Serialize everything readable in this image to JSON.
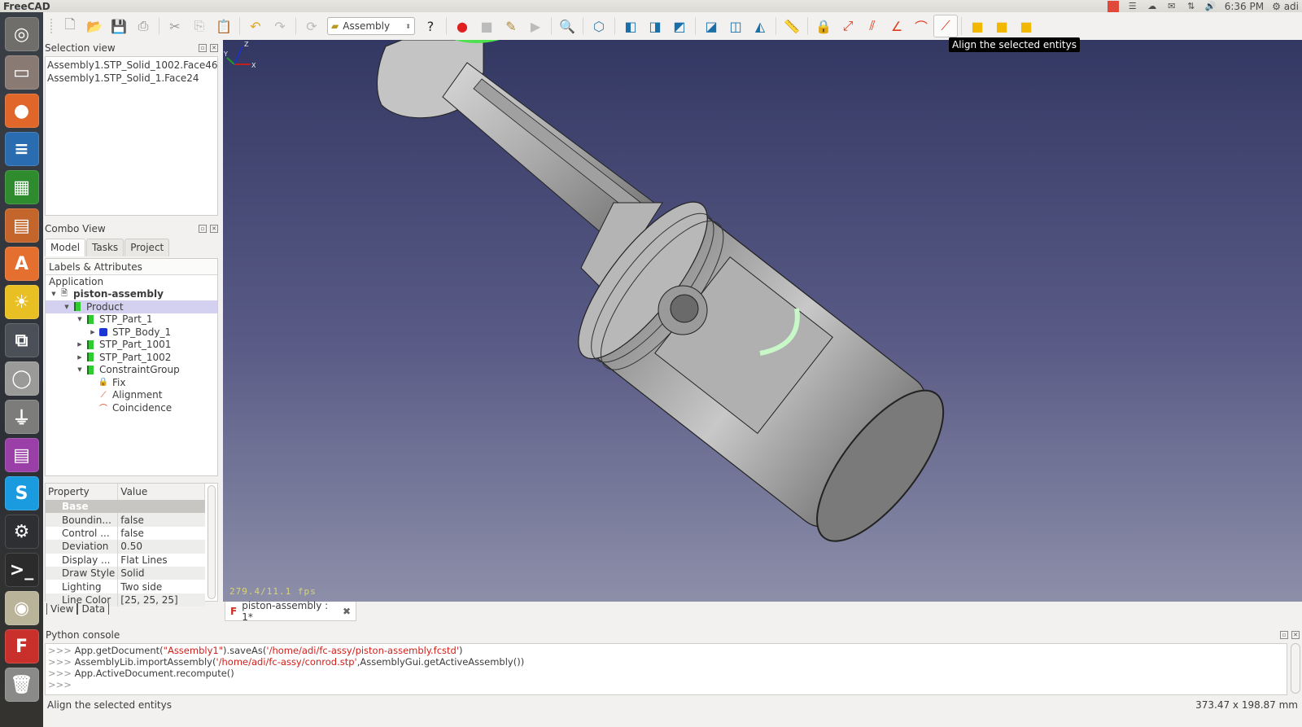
{
  "topbar": {
    "app_title": "FreeCAD",
    "clock": "6:36 PM",
    "user": "adi",
    "tray_icons": [
      "record-indicator",
      "notes-icon",
      "cloud-icon",
      "mail-icon",
      "network-icon",
      "volume-icon"
    ]
  },
  "launcher": {
    "items": [
      {
        "name": "dash-home",
        "glyph": "◎",
        "color": "#6f6e6a"
      },
      {
        "name": "files",
        "glyph": "▭",
        "color": "#8a7a74"
      },
      {
        "name": "firefox",
        "glyph": "●",
        "color": "#e0662a"
      },
      {
        "name": "writer",
        "glyph": "≡",
        "color": "#2a6cb0"
      },
      {
        "name": "calc",
        "glyph": "▦",
        "color": "#2e8b2e"
      },
      {
        "name": "impress",
        "glyph": "▤",
        "color": "#c4652c"
      },
      {
        "name": "software-center",
        "glyph": "A",
        "color": "#e46f2e"
      },
      {
        "name": "weather",
        "glyph": "☀",
        "color": "#e9c023"
      },
      {
        "name": "workspaces",
        "glyph": "⧉",
        "color": "#4b4f58"
      },
      {
        "name": "disk",
        "glyph": "◯",
        "color": "#9a9a98"
      },
      {
        "name": "usb",
        "glyph": "⏚",
        "color": "#7c7c7a"
      },
      {
        "name": "app-window",
        "glyph": "▤",
        "color": "#9b3fa8"
      },
      {
        "name": "skype",
        "glyph": "S",
        "color": "#1a9be0"
      },
      {
        "name": "steam",
        "glyph": "⚙",
        "color": "#2d2f33"
      },
      {
        "name": "terminal",
        "glyph": ">_",
        "color": "#2b2b2b"
      },
      {
        "name": "speaker",
        "glyph": "◉",
        "color": "#b9b39a"
      },
      {
        "name": "freecad",
        "glyph": "F",
        "color": "#c9302c"
      },
      {
        "name": "trash",
        "glyph": "🗑",
        "color": "#8a8a88"
      }
    ]
  },
  "toolbar": {
    "workbench": "Assembly",
    "tooltip": "Align the selected entitys",
    "buttons": [
      {
        "name": "new",
        "glyph": "🗋",
        "color": "#888"
      },
      {
        "name": "open",
        "glyph": "📂",
        "color": "#2a6cb0"
      },
      {
        "name": "save",
        "glyph": "💾",
        "color": "#2a6cb0"
      },
      {
        "name": "print",
        "glyph": "⎙",
        "color": "#888"
      },
      {
        "name": "cut",
        "glyph": "✂",
        "color": "#999"
      },
      {
        "name": "copy",
        "glyph": "⎘",
        "color": "#bbb"
      },
      {
        "name": "paste",
        "glyph": "📋",
        "color": "#999"
      },
      {
        "name": "undo",
        "glyph": "↶",
        "color": "#e0a820"
      },
      {
        "name": "redo",
        "glyph": "↷",
        "color": "#bbb"
      },
      {
        "name": "refresh",
        "glyph": "⟳",
        "color": "#bbb"
      }
    ],
    "buttons2": [
      {
        "name": "whats-this",
        "glyph": "?",
        "color": "#222"
      },
      {
        "name": "macro-record",
        "glyph": "●",
        "color": "#e02020"
      },
      {
        "name": "macro-stop",
        "glyph": "■",
        "color": "#bbb"
      },
      {
        "name": "macro-edit",
        "glyph": "✎",
        "color": "#b08a3a"
      },
      {
        "name": "macro-play",
        "glyph": "▶",
        "color": "#bbb"
      },
      {
        "name": "fit-all",
        "glyph": "🔍",
        "color": "#1a66a8"
      },
      {
        "name": "view-isometric",
        "glyph": "⬡",
        "color": "#3a7fa8"
      },
      {
        "name": "view-front",
        "glyph": "◧",
        "color": "#1a6fa8"
      },
      {
        "name": "view-top",
        "glyph": "◨",
        "color": "#1a6fa8"
      },
      {
        "name": "view-right",
        "glyph": "◩",
        "color": "#1a6fa8"
      },
      {
        "name": "view-rear",
        "glyph": "◪",
        "color": "#1a6fa8"
      },
      {
        "name": "view-bottom",
        "glyph": "◫",
        "color": "#1a6fa8"
      },
      {
        "name": "view-left",
        "glyph": "◭",
        "color": "#1a6fa8"
      },
      {
        "name": "measure",
        "glyph": "📏",
        "color": "#1a4f78"
      },
      {
        "name": "constraint-fix",
        "glyph": "🔒",
        "color": "#e03a1a"
      },
      {
        "name": "constraint-distance",
        "glyph": "⤢",
        "color": "#e03a1a"
      },
      {
        "name": "constraint-parallel",
        "glyph": "⫽",
        "color": "#e03a1a"
      },
      {
        "name": "constraint-angle",
        "glyph": "∠",
        "color": "#e03a1a"
      },
      {
        "name": "constraint-coincidence",
        "glyph": "⌒",
        "color": "#e03a1a"
      },
      {
        "name": "constraint-align",
        "glyph": "⟋",
        "color": "#e03a1a"
      },
      {
        "name": "part-add-1",
        "glyph": "■",
        "color": "#f2b800"
      },
      {
        "name": "part-add-2",
        "glyph": "■",
        "color": "#f2b800"
      },
      {
        "name": "part-add-3",
        "glyph": "■",
        "color": "#f2b800"
      }
    ]
  },
  "selection_view": {
    "title": "Selection view",
    "items": [
      "Assembly1.STP_Solid_1002.Face46",
      "Assembly1.STP_Solid_1.Face24"
    ]
  },
  "combo_view": {
    "title": "Combo View",
    "tabs": [
      "Model",
      "Tasks",
      "Project"
    ],
    "tree_header": "Labels & Attributes",
    "tree": [
      {
        "label": "Application",
        "depth": 0,
        "twisty": "",
        "icon": "none",
        "bold": false
      },
      {
        "label": "piston-assembly",
        "depth": 0,
        "twisty": "▼",
        "icon": "document",
        "bold": true
      },
      {
        "label": "Product",
        "depth": 1,
        "twisty": "▼",
        "icon": "part",
        "bold": false,
        "selected": true
      },
      {
        "label": "STP_Part_1",
        "depth": 2,
        "twisty": "▼",
        "icon": "part",
        "bold": false
      },
      {
        "label": "STP_Body_1",
        "depth": 3,
        "twisty": "▶",
        "icon": "body",
        "bold": false
      },
      {
        "label": "STP_Part_1001",
        "depth": 2,
        "twisty": "▶",
        "icon": "part",
        "bold": false
      },
      {
        "label": "STP_Part_1002",
        "depth": 2,
        "twisty": "▶",
        "icon": "part",
        "bold": false
      },
      {
        "label": "ConstraintGroup",
        "depth": 2,
        "twisty": "▼",
        "icon": "part",
        "bold": false
      },
      {
        "label": "Fix",
        "depth": 3,
        "twisty": "",
        "icon": "lock",
        "bold": false
      },
      {
        "label": "Alignment",
        "depth": 3,
        "twisty": "",
        "icon": "align",
        "bold": false
      },
      {
        "label": "Coincidence",
        "depth": 3,
        "twisty": "",
        "icon": "coincide",
        "bold": false
      }
    ],
    "property_header": [
      "Property",
      "Value"
    ],
    "property_group": "Base",
    "properties": [
      {
        "name": "Boundin...",
        "value": "false"
      },
      {
        "name": "Control ...",
        "value": "false"
      },
      {
        "name": "Deviation",
        "value": "0.50"
      },
      {
        "name": "Display ...",
        "value": "Flat Lines"
      },
      {
        "name": "Draw Style",
        "value": "Solid"
      },
      {
        "name": "Lighting",
        "value": "Two side"
      },
      {
        "name": "Line Color",
        "value": "[25, 25, 25]"
      }
    ],
    "property_tabs": [
      "View",
      "Data"
    ]
  },
  "viewport": {
    "fps": "279.4/11.1 fps",
    "axis_labels": {
      "x": "X",
      "y": "Y",
      "z": "Z"
    }
  },
  "document_tab": {
    "label": "piston-assembly : 1*"
  },
  "console": {
    "title": "Python console",
    "prompt": ">>>",
    "lines": [
      {
        "pre": "App.getDocument(",
        "str": "\"Assembly1\"",
        "post": ").saveAs(",
        "str2": "'/home/adi/fc-assy/piston-assembly.fcstd'",
        "end": ")"
      },
      {
        "pre": "AssemblyLib.importAssembly(",
        "str": "'/home/adi/fc-assy/conrod.stp'",
        "post": ",AssemblyGui.getActiveAssembly()",
        "str2": "",
        "end": ")"
      },
      {
        "pre": "App.ActiveDocument.recompute()",
        "str": "",
        "post": "",
        "str2": "",
        "end": ""
      }
    ]
  },
  "statusbar": {
    "message": "Align the selected entitys",
    "dimensions": "373.47 x 198.87 mm"
  }
}
